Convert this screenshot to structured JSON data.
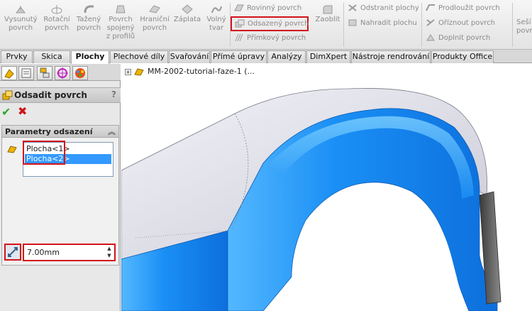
{
  "ribbon": {
    "big_buttons": [
      {
        "label": "Vysunutý\npovrch",
        "icon": "extrude-surface-icon"
      },
      {
        "label": "Rotační\npovrch",
        "icon": "revolve-surface-icon"
      },
      {
        "label": "Tažený\npovrch",
        "icon": "sweep-surface-icon"
      },
      {
        "label": "Povrch\nspojený\nz profilů",
        "icon": "loft-surface-icon"
      },
      {
        "label": "Hraniční\npovrch",
        "icon": "boundary-surface-icon"
      },
      {
        "label": "Záplata",
        "icon": "patch-icon"
      },
      {
        "label": "Volný\ntvar",
        "icon": "freeform-icon"
      }
    ],
    "small_col1": [
      {
        "label": "Rovinný povrch",
        "icon": "planar-surface-icon"
      },
      {
        "label": "Odsazený povrch",
        "icon": "offset-surface-icon",
        "highlighted": true
      },
      {
        "label": "Přímkový povrch",
        "icon": "ruled-surface-icon"
      }
    ],
    "fillet": {
      "label": "Zaoblit",
      "icon": "fillet-icon"
    },
    "small_col2": [
      {
        "label": "Odstranit plochy",
        "icon": "delete-face-icon"
      },
      {
        "label": "Nahradit plochu",
        "icon": "replace-face-icon"
      }
    ],
    "small_col3": [
      {
        "label": "Prodloužit povrch",
        "icon": "extend-surface-icon"
      },
      {
        "label": "Oříznout povrch",
        "icon": "trim-surface-icon"
      },
      {
        "label": "Doplnit povrch",
        "icon": "untrim-surface-icon"
      }
    ],
    "cut_label": "Seší\npovrc"
  },
  "tabs": [
    "Prvky",
    "Skica",
    "Plochy",
    "Plechové díly",
    "Svařování",
    "Přímé úpravy",
    "Analýzy",
    "DimXpert",
    "Nástroje rendrování",
    "Produkty Office"
  ],
  "active_tab": "Plochy",
  "panel": {
    "title": "Odsadit povrch",
    "help": "?",
    "group_title": "Parametry odsazení",
    "faces": [
      "Plocha<1>",
      "Plocha<2>"
    ],
    "selected_face_index": 1,
    "distance": "7.00mm"
  },
  "viewport": {
    "tree_root": "MM-2002-tutorial-faze-1  (..."
  },
  "colors": {
    "highlight_red": "#d4121a",
    "selection_blue": "#3399ff",
    "model_blue": "#1a8ff5"
  }
}
